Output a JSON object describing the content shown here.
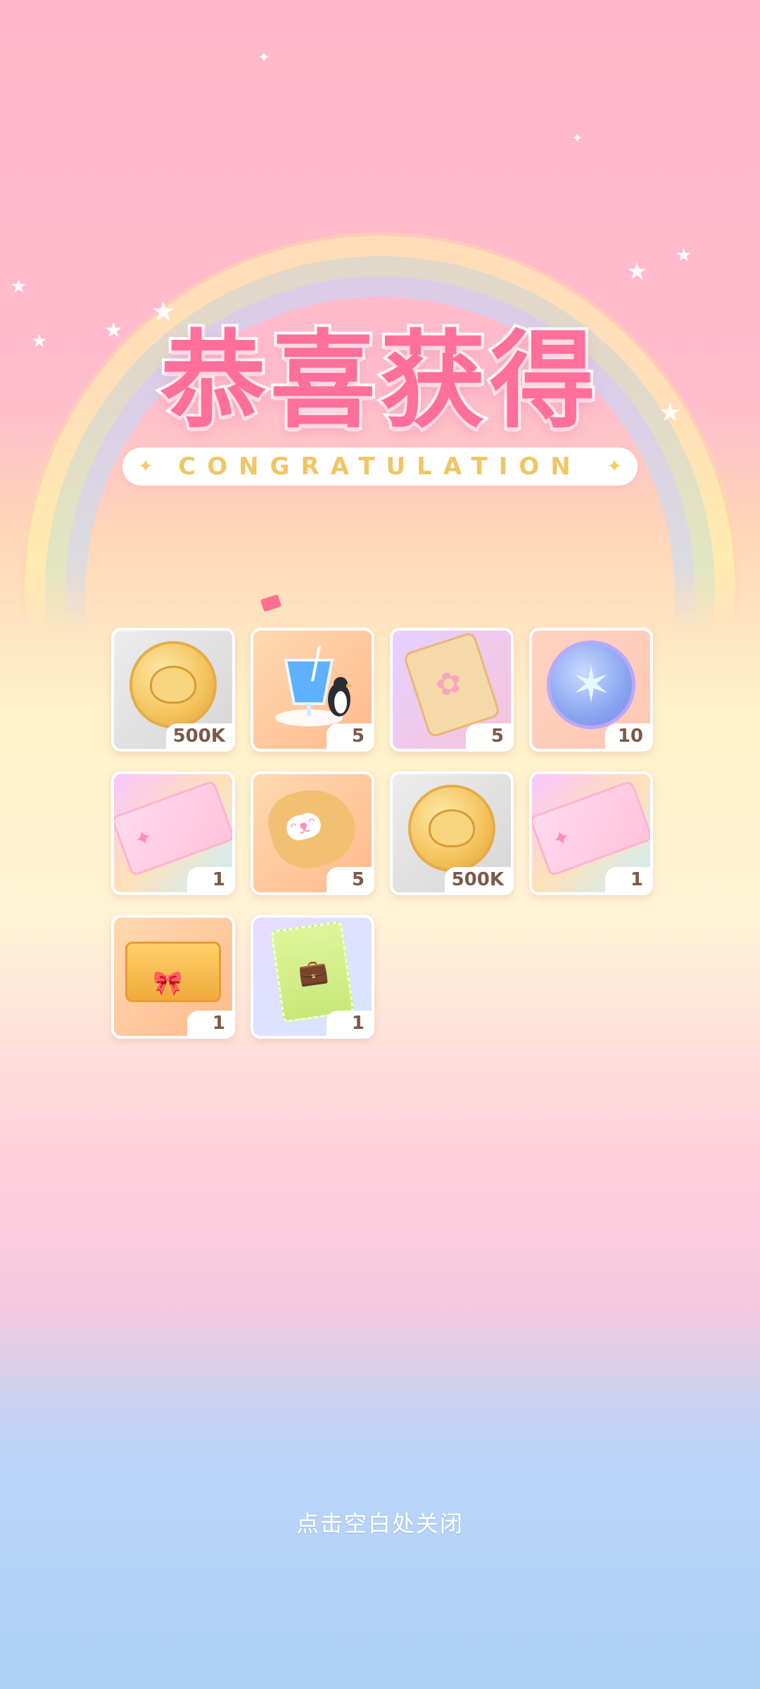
{
  "title": "恭喜获得",
  "subtitle": "CONGRATULATION",
  "close_hint": "点击空白处关闭",
  "colors": {
    "accent_pink": "#ff6f9b",
    "gold": "#f0c566"
  },
  "rewards": [
    {
      "icon": "koala-coin-icon",
      "qty": "500K"
    },
    {
      "icon": "penguin-drink-icon",
      "qty": "5"
    },
    {
      "icon": "sakura-charm-icon",
      "qty": "5"
    },
    {
      "icon": "compass-medal-icon",
      "qty": "10"
    },
    {
      "icon": "pink-ticket-icon",
      "qty": "1"
    },
    {
      "icon": "bunny-pouch-icon",
      "qty": "5"
    },
    {
      "icon": "koala-coin-icon",
      "qty": "500K"
    },
    {
      "icon": "pink-ticket-icon",
      "qty": "1"
    },
    {
      "icon": "gift-box-icon",
      "qty": "1"
    },
    {
      "icon": "green-voucher-icon",
      "qty": "1"
    }
  ]
}
